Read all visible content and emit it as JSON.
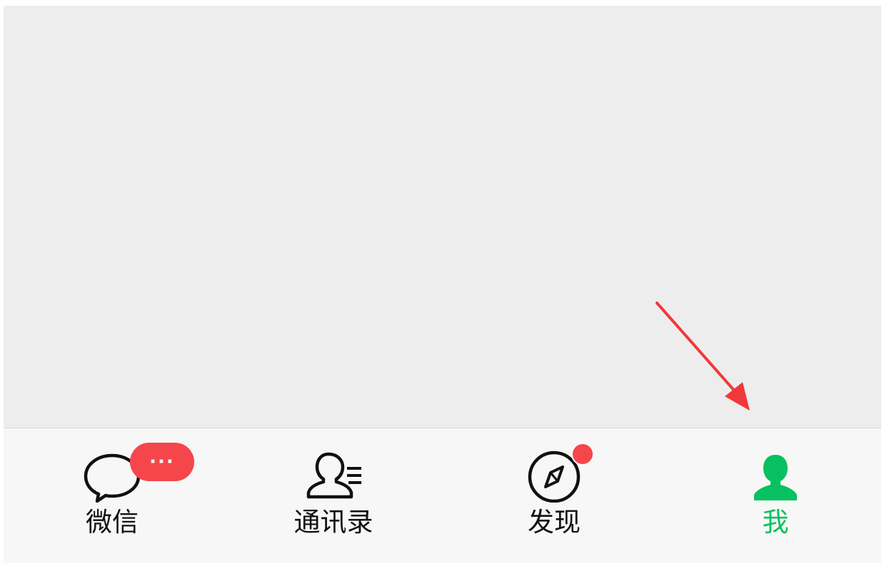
{
  "tabbar": {
    "tabs": [
      {
        "id": "chats",
        "label": "微信",
        "icon": "chat-bubble-icon",
        "badge": "···"
      },
      {
        "id": "contacts",
        "label": "通讯录",
        "icon": "contacts-icon"
      },
      {
        "id": "discover",
        "label": "发现",
        "icon": "compass-icon",
        "badge_dot": true
      },
      {
        "id": "me",
        "label": "我",
        "icon": "person-icon",
        "active": true
      }
    ]
  },
  "colors": {
    "active": "#07c160",
    "badge": "#f5464b",
    "arrow": "#f2383a",
    "background": "#ededed",
    "tabbar": "#f7f7f7"
  },
  "annotation": {
    "type": "arrow",
    "points_to": "tab-me"
  }
}
